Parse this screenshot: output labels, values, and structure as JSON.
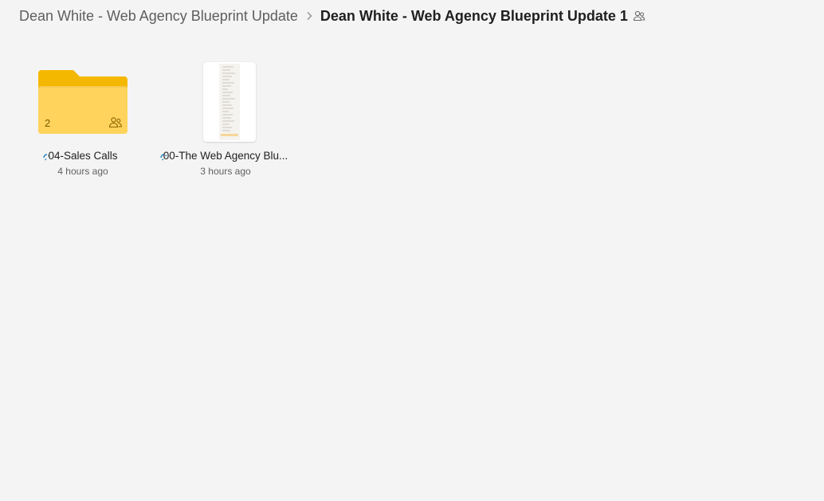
{
  "breadcrumb": {
    "parent": "Dean White - Web Agency Blueprint Update",
    "current": "Dean White - Web Agency Blueprint Update 1",
    "separator_icon": "chevron-right-icon",
    "shared_icon": "people-icon"
  },
  "items": [
    {
      "type": "folder",
      "name": "04-Sales Calls",
      "modified": "4 hours ago",
      "count": "2",
      "shared_icon": "people-icon",
      "status_icon": "sync-icon"
    },
    {
      "type": "document",
      "name": "00-The Web Agency Blu...",
      "modified": "3 hours ago",
      "status_icon": "sync-icon"
    }
  ],
  "colors": {
    "background": "#f4f4f4",
    "folder_front": "#ffd35c",
    "folder_back": "#f5b800",
    "sync_accent": "#1f7fb8"
  }
}
